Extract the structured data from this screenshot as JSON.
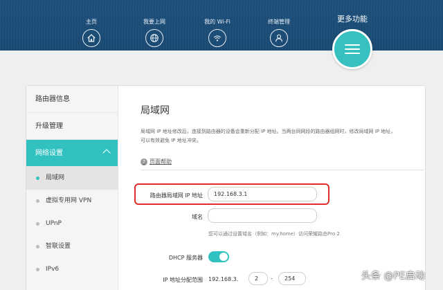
{
  "header": {
    "nav": [
      {
        "label": "主页",
        "icon": "home-icon"
      },
      {
        "label": "我要上网",
        "icon": "globe-icon"
      },
      {
        "label": "我的 Wi-Fi",
        "icon": "wifi-icon"
      },
      {
        "label": "终端管理",
        "icon": "user-icon"
      }
    ],
    "more_label": "更多功能",
    "more_icon": "menu-icon"
  },
  "sidebar": {
    "items": [
      {
        "label": "路由器信息"
      },
      {
        "label": "升级管理"
      },
      {
        "label": "网络设置"
      }
    ],
    "sub_items": [
      {
        "label": "局域网"
      },
      {
        "label": "虚拟专用网 VPN"
      },
      {
        "label": "UPnP"
      },
      {
        "label": "智联设置"
      },
      {
        "label": "IPv6"
      }
    ]
  },
  "content": {
    "title": "局域网",
    "desc_line1": "局域网 IP 地址修改后，连接到路由器的设备会重新分配 IP 地址。当两台同网段的路由器组网时，修改局域网 IP 地址，",
    "desc_line2": "可以有效避免 IP 地址冲突。",
    "help_label": "页面帮助",
    "ip_label": "路由器局域网 IP 地址",
    "ip_value": "192.168.3.1",
    "domain_label": "域名",
    "domain_value": "",
    "domain_hint": "您可以通过设置域名（例如：my.home）访问荣耀路由Pro 2",
    "dhcp_label": "DHCP 服务器",
    "dhcp_on": true,
    "range_label": "IP 地址分配范围",
    "range_prefix": "192.168.3.",
    "range_start": "2",
    "range_sep": "-",
    "range_end": "254"
  },
  "watermark": "头条 @PE启动",
  "colors": {
    "accent": "#32c1c1",
    "header": "#1d4f7a",
    "highlight": "#e02b2b"
  }
}
